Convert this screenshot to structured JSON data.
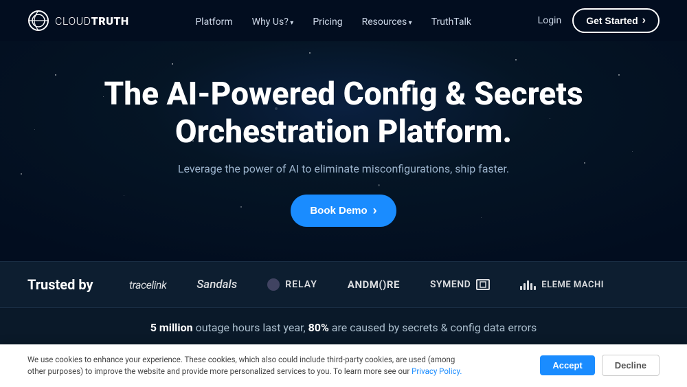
{
  "nav": {
    "logo_text_cloud": "CLOUD",
    "logo_text_truth": "TRUTH",
    "links": [
      {
        "label": "Platform",
        "id": "platform",
        "has_arrow": false
      },
      {
        "label": "Why Us?",
        "id": "why-us",
        "has_arrow": true
      },
      {
        "label": "Pricing",
        "id": "pricing",
        "has_arrow": false
      },
      {
        "label": "Resources",
        "id": "resources",
        "has_arrow": true
      },
      {
        "label": "TruthTalk",
        "id": "truthtalk",
        "has_arrow": false
      }
    ],
    "login_label": "Login",
    "cta_label": "Get Started"
  },
  "hero": {
    "title_line1": "The AI-Powered Config & Secrets",
    "title_line2": "Orchestration Platform.",
    "subtitle": "Leverage the power of AI to eliminate misconfigurations, ship faster.",
    "cta_label": "Book Demo"
  },
  "trusted": {
    "label": "Trusted by",
    "brands": [
      {
        "id": "tracelink",
        "name": "tracelink",
        "class": "tracelink"
      },
      {
        "id": "sandals",
        "name": "Sandals",
        "class": "sandals"
      },
      {
        "id": "relay",
        "name": "RELAY",
        "class": "relay"
      },
      {
        "id": "andmore",
        "name": "ANDM()RE",
        "class": "andmore"
      },
      {
        "id": "symend",
        "name": "SYMEND",
        "class": "symend"
      },
      {
        "id": "element",
        "name": "ELEME MACHI",
        "class": "element"
      }
    ]
  },
  "stat": {
    "bold1": "5 million",
    "text1": " outage hours last year, ",
    "bold2": "80%",
    "text2": " are caused by secrets & config data errors"
  },
  "cookie": {
    "text": "We use cookies to enhance your experience. These cookies, which also could include third-party cookies, are used (among other purposes) to improve the website and provide more personalized services to you. To learn more see our ",
    "link_text": "Privacy Policy.",
    "accept_label": "Accept",
    "decline_label": "Decline"
  }
}
